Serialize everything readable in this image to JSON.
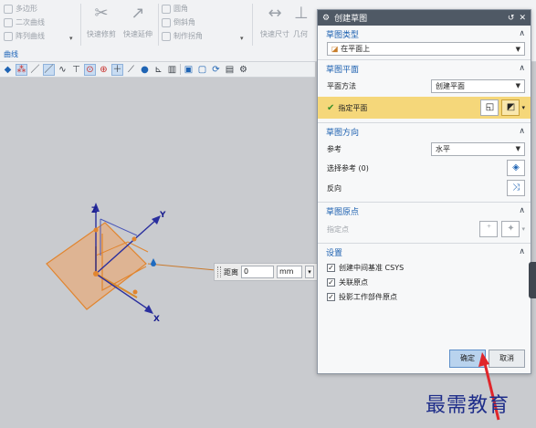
{
  "ribbon": {
    "col1": [
      "多边形",
      "二次曲线",
      "阵列曲线"
    ],
    "big1": "快速修剪",
    "big2": "快速延伸",
    "col2": [
      "圆角",
      "倒斜角",
      "制作拐角"
    ],
    "big3": "快速尺寸",
    "big4": "几何",
    "group_label": "曲线"
  },
  "toolbar": {
    "icons": [
      "cube-icon",
      "snap-icon",
      "line-icon",
      "line-icon",
      "curve-icon",
      "tangent-icon",
      "point-icon",
      "target-icon",
      "plus-icon",
      "slash-icon",
      "sphere-icon",
      "axis-icon",
      "copy-icon",
      "view-icon",
      "view-icon",
      "rotate-icon",
      "layer-icon",
      "gear-icon"
    ]
  },
  "viewport": {
    "axes": {
      "x": "X",
      "y": "Y",
      "z": "Z"
    },
    "distance": {
      "label": "距离",
      "value": "0",
      "unit": "mm"
    }
  },
  "dialog": {
    "title": "创建草图",
    "sketch_type": {
      "heading": "草图类型",
      "value": "在平面上"
    },
    "sketch_plane": {
      "heading": "草图平面",
      "method_label": "平面方法",
      "method_value": "创建平面",
      "specify_plane": "指定平面"
    },
    "sketch_orientation": {
      "heading": "草图方向",
      "reference_label": "参考",
      "reference_value": "水平",
      "select_reference": "选择参考 (0)",
      "reverse": "反向"
    },
    "sketch_origin": {
      "heading": "草图原点",
      "specify_point": "指定点"
    },
    "settings": {
      "heading": "设置",
      "options": [
        {
          "label": "创建中间基准 CSYS",
          "checked": true
        },
        {
          "label": "关联原点",
          "checked": true
        },
        {
          "label": "投影工作部件原点",
          "checked": true
        }
      ]
    },
    "ok": "确定",
    "cancel": "取消"
  },
  "watermark": "最需教育",
  "colors": {
    "accent": "#1b5fb0",
    "highlight": "#f5d77a",
    "plane": "#e7a979",
    "plane_edge": "#e1852f",
    "arrow": "#e0262b"
  }
}
